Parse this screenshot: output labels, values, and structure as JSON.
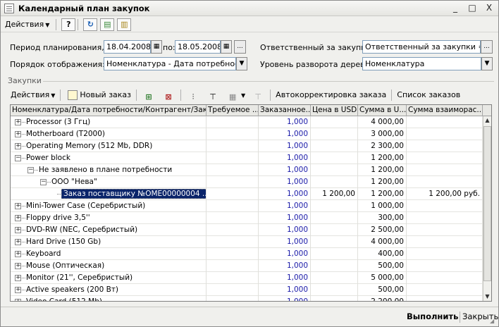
{
  "window": {
    "title": "Календарный план закупок",
    "buttons": [
      "_",
      "□",
      "X"
    ]
  },
  "menubar": {
    "actions_label": "Действия",
    "help_label": "?"
  },
  "filters": {
    "period_label": "Период планирования, с:",
    "date_from": "18.04.2008",
    "to_label": "по:",
    "date_to": "18.05.2008",
    "ellipsis": "...",
    "responsible_label": "Ответственный за закупки:",
    "responsible_value": "Ответственный за закупки = \"Л",
    "order_label": "Порядок отображения:",
    "order_value": "Номенклатура - Дата потребности -",
    "tree_label": "Уровень разворота дерева:",
    "tree_value": "Номенклатура"
  },
  "purchases": {
    "section_title": "Закупки",
    "toolbar": {
      "actions_label": "Действия",
      "new_order_label": "Новый заказ",
      "auto_correct_label": "Автокорректировка заказа",
      "orders_list_label": "Список заказов"
    },
    "columns": [
      "Номенклатура/Дата потребности/Контрагент/Заказ",
      "Требуемое ...",
      "Заказанное...",
      "Цена в USD",
      "Сумма в U...",
      "Сумма взаиморас..."
    ],
    "rows": [
      {
        "level": 0,
        "toggle": "+",
        "name": "Processor (3 Ггц)",
        "required": "",
        "ordered": "1,000",
        "price": "",
        "sum": "4 000,00",
        "settlement": ""
      },
      {
        "level": 0,
        "toggle": "+",
        "name": "Motherboard (T2000)",
        "required": "",
        "ordered": "1,000",
        "price": "",
        "sum": "3 000,00",
        "settlement": ""
      },
      {
        "level": 0,
        "toggle": "+",
        "name": "Operating Memory (512 Mb, DDR)",
        "required": "",
        "ordered": "1,000",
        "price": "",
        "sum": "2 300,00",
        "settlement": ""
      },
      {
        "level": 0,
        "toggle": "-",
        "name": "Power block",
        "required": "",
        "ordered": "1,000",
        "price": "",
        "sum": "1 200,00",
        "settlement": ""
      },
      {
        "level": 1,
        "toggle": "-",
        "name": "Не заявлено в плане потребности",
        "required": "",
        "ordered": "1,000",
        "price": "",
        "sum": "1 200,00",
        "settlement": ""
      },
      {
        "level": 2,
        "toggle": "-",
        "name": "ООО \"Нева\"",
        "required": "",
        "ordered": "1,000",
        "price": "",
        "sum": "1 200,00",
        "settlement": ""
      },
      {
        "level": 3,
        "toggle": "",
        "name": "Заказ поставщику №ОМЕ00000004 ...",
        "required": "",
        "ordered": "1,000",
        "price": "1 200,00",
        "sum": "1 200,00",
        "settlement": "1 200,00 руб.",
        "selected": true
      },
      {
        "level": 0,
        "toggle": "+",
        "name": "Mini-Tower Case (Серебристый)",
        "required": "",
        "ordered": "1,000",
        "price": "",
        "sum": "1 000,00",
        "settlement": ""
      },
      {
        "level": 0,
        "toggle": "+",
        "name": "Floppy drive 3,5''",
        "required": "",
        "ordered": "1,000",
        "price": "",
        "sum": "300,00",
        "settlement": ""
      },
      {
        "level": 0,
        "toggle": "+",
        "name": "DVD-RW (NEC, Серебристый)",
        "required": "",
        "ordered": "1,000",
        "price": "",
        "sum": "2 500,00",
        "settlement": ""
      },
      {
        "level": 0,
        "toggle": "+",
        "name": "Hard Drive (150 Gb)",
        "required": "",
        "ordered": "1,000",
        "price": "",
        "sum": "4 000,00",
        "settlement": ""
      },
      {
        "level": 0,
        "toggle": "+",
        "name": "Keyboard",
        "required": "",
        "ordered": "1,000",
        "price": "",
        "sum": "400,00",
        "settlement": ""
      },
      {
        "level": 0,
        "toggle": "+",
        "name": "Mouse (Оптическая)",
        "required": "",
        "ordered": "1,000",
        "price": "",
        "sum": "500,00",
        "settlement": ""
      },
      {
        "level": 0,
        "toggle": "+",
        "name": "Monitor (21'', Серебристый)",
        "required": "",
        "ordered": "1,000",
        "price": "",
        "sum": "5 000,00",
        "settlement": ""
      },
      {
        "level": 0,
        "toggle": "+",
        "name": "Active speakers (200 Вт)",
        "required": "",
        "ordered": "1,000",
        "price": "",
        "sum": "500,00",
        "settlement": ""
      },
      {
        "level": 0,
        "toggle": "+",
        "name": "Video Card (512 Mb)",
        "required": "",
        "ordered": "1,000",
        "price": "",
        "sum": "2 200,00",
        "settlement": ""
      }
    ]
  },
  "footer": {
    "run_label": "Выполнить",
    "close_label": "Закрыть"
  },
  "colors": {
    "ordered_value": "#1a1aa8",
    "selection": "#0a246a"
  }
}
